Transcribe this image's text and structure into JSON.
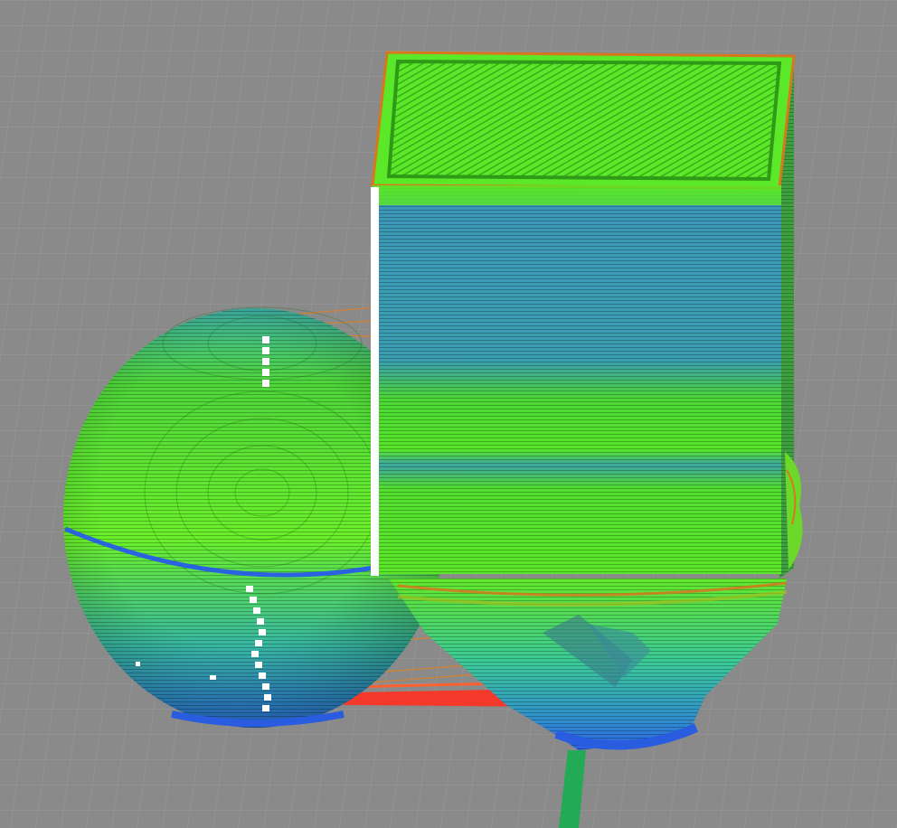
{
  "viewport": {
    "background_color": "#8a8a8a",
    "grid_color": "#9a9a9a"
  },
  "objects": [
    {
      "id": "sphere",
      "kind": "sphere",
      "layers": "concentric-perimeters"
    },
    {
      "id": "box",
      "kind": "box-with-support-base",
      "layers": "horizontal-perimeters"
    }
  ],
  "markers": {
    "seam_color": "#ffffff",
    "travel_color": "#e08020",
    "skirt_color": "#ff3020",
    "axis_color": "#22aa55"
  },
  "colors": {
    "green": "#5be828",
    "green_dark": "#2f9a18",
    "teal": "#3aa3a8",
    "blue": "#2a6fd8",
    "orange": "#d8781e"
  }
}
